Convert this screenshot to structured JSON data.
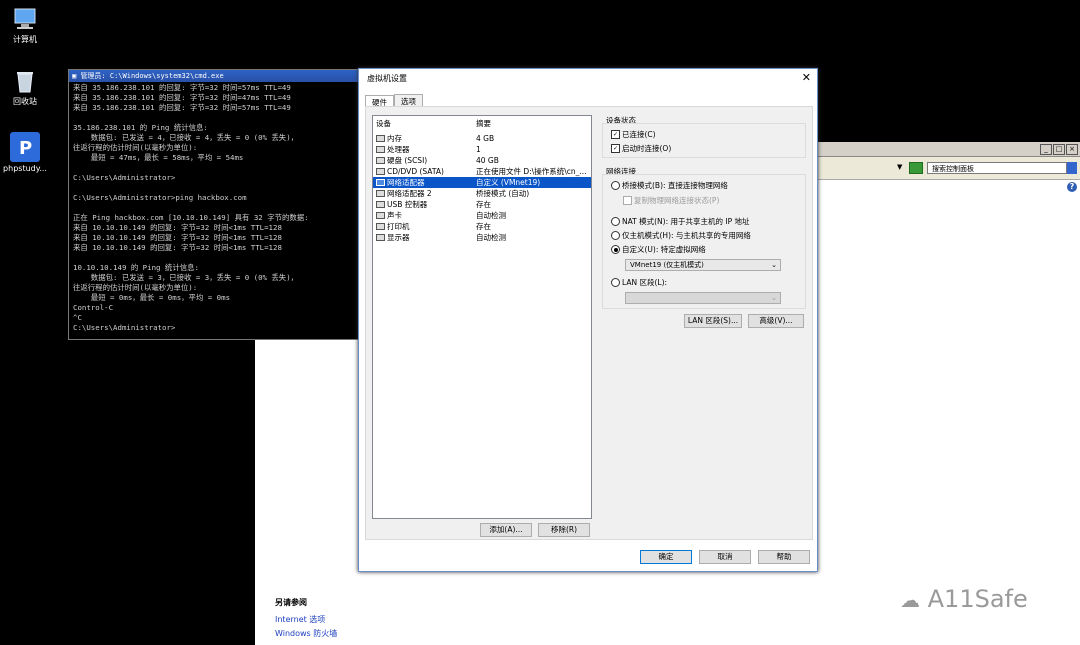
{
  "desktop": {
    "icons": [
      {
        "label": "计算机",
        "icon": "computer-icon"
      },
      {
        "label": "回收站",
        "icon": "recycle-bin-icon"
      },
      {
        "label": "phpstudy...",
        "icon": "phpstudy-icon"
      }
    ]
  },
  "cmd": {
    "title": "管理员: C:\\Windows\\system32\\cmd.exe",
    "lines": [
      "来自 35.186.238.101 的回复: 字节=32 时间=57ms TTL=49",
      "来自 35.186.238.101 的回复: 字节=32 时间=47ms TTL=49",
      "来自 35.186.238.101 的回复: 字节=32 时间=57ms TTL=49",
      "",
      "35.186.238.101 的 Ping 统计信息:",
      "    数据包: 已发送 = 4，已接收 = 4，丢失 = 0 (0% 丢失)，",
      "往返行程的估计时间(以毫秒为单位):",
      "    最短 = 47ms，最长 = 58ms，平均 = 54ms",
      "",
      "C:\\Users\\Administrator>",
      "",
      "C:\\Users\\Administrator>ping hackbox.com",
      "",
      "正在 Ping hackbox.com [10.10.10.149] 具有 32 字节的数据:",
      "来自 10.10.10.149 的回复: 字节=32 时间<1ms TTL=128",
      "来自 10.10.10.149 的回复: 字节=32 时间<1ms TTL=128",
      "来自 10.10.10.149 的回复: 字节=32 时间<1ms TTL=128",
      "",
      "10.10.10.149 的 Ping 统计信息:",
      "    数据包: 已发送 = 3，已接收 = 3，丢失 = 0 (0% 丢失)，",
      "往返行程的估计时间(以毫秒为单位):",
      "    最短 = 0ms，最长 = 0ms，平均 = 0ms",
      "Control-C",
      "^C",
      "C:\\Users\\Administrator>"
    ]
  },
  "control_panel": {
    "search_placeholder": "搜索控制面板",
    "see_also_title": "另请参阅",
    "see_also_links": [
      "Internet 选项",
      "Windows 防火墙"
    ]
  },
  "watermark": "A11Safe",
  "dialog": {
    "title": "虚拟机设置",
    "tabs": [
      "硬件",
      "选项"
    ],
    "list_headers": {
      "device": "设备",
      "summary": "摘要"
    },
    "devices": [
      {
        "name": "内存",
        "summary": "4 GB",
        "icon": "memory-icon",
        "selected": false
      },
      {
        "name": "处理器",
        "summary": "1",
        "icon": "cpu-icon",
        "selected": false
      },
      {
        "name": "硬盘 (SCSI)",
        "summary": "40 GB",
        "icon": "harddisk-icon",
        "selected": false
      },
      {
        "name": "CD/DVD (SATA)",
        "summary": "正在使用文件 D:\\操作系统\\cn_...",
        "icon": "cdrom-icon",
        "selected": false
      },
      {
        "name": "网络适配器",
        "summary": "自定义 (VMnet19)",
        "icon": "network-adapter-icon",
        "selected": true
      },
      {
        "name": "网络适配器 2",
        "summary": "桥接模式 (自动)",
        "icon": "network-adapter-icon",
        "selected": false
      },
      {
        "name": "USB 控制器",
        "summary": "存在",
        "icon": "usb-icon",
        "selected": false
      },
      {
        "name": "声卡",
        "summary": "自动检测",
        "icon": "sound-icon",
        "selected": false
      },
      {
        "name": "打印机",
        "summary": "存在",
        "icon": "printer-icon",
        "selected": false
      },
      {
        "name": "显示器",
        "summary": "自动检测",
        "icon": "display-icon",
        "selected": false
      }
    ],
    "add_button": "添加(A)...",
    "remove_button": "移除(R)",
    "device_status": {
      "title": "设备状态",
      "connected": "已连接(C)",
      "connect_at_power_on": "启动时连接(O)"
    },
    "network": {
      "title": "网络连接",
      "bridged": "桥接模式(B): 直接连接物理网络",
      "replicate": "复制物理网络连接状态(P)",
      "nat": "NAT 模式(N): 用于共享主机的 IP 地址",
      "host_only": "仅主机模式(H): 与主机共享的专用网络",
      "custom": "自定义(U): 特定虚拟网络",
      "custom_value": "VMnet19 (仅主机模式)",
      "lan_segment": "LAN 区段(L):",
      "lan_segment_value": ""
    },
    "lan_segments_button": "LAN 区段(S)...",
    "advanced_button": "高级(V)...",
    "ok_button": "确定",
    "cancel_button": "取消",
    "help_button": "帮助"
  }
}
